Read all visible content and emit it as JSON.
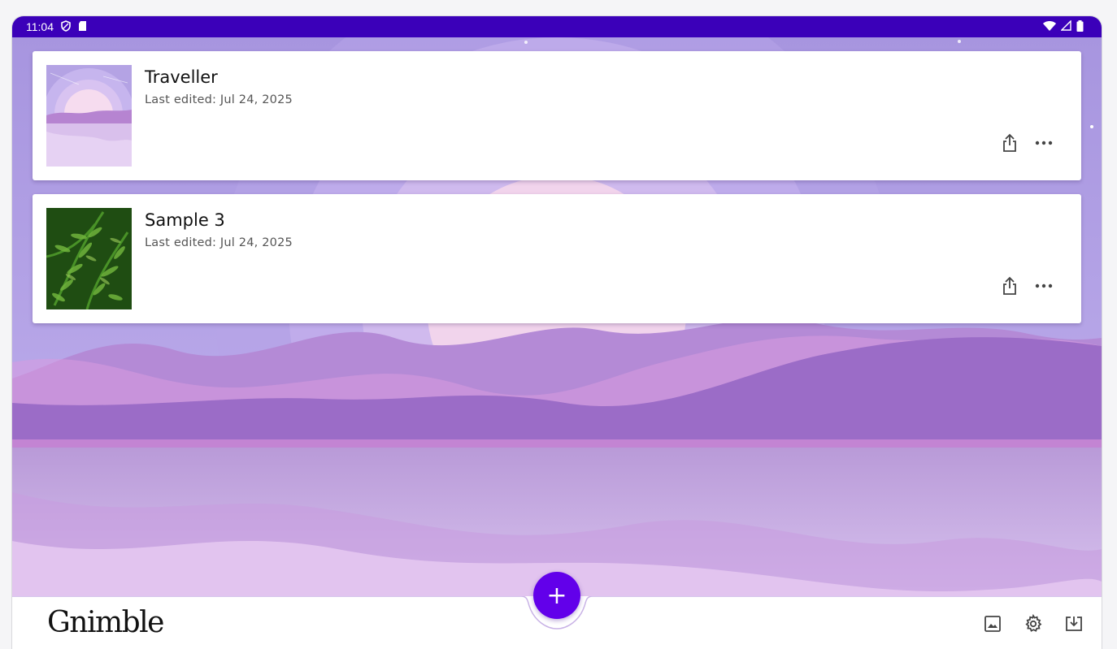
{
  "status_bar": {
    "time": "11:04",
    "icons_left": [
      "shield-icon",
      "sd-card-icon"
    ],
    "icons_right": [
      "wifi-icon",
      "cell-signal-icon",
      "battery-icon"
    ],
    "color": "#3b00b9"
  },
  "projects": [
    {
      "title": "Traveller",
      "subtitle": "Last edited: Jul 24, 2025",
      "thumbnail": "sunset-lake-thumbnail"
    },
    {
      "title": "Sample 3",
      "subtitle": "Last edited: Jul 24, 2025",
      "thumbnail": "fern-leaves-thumbnail"
    }
  ],
  "card_actions": [
    "share-icon",
    "more-options-icon"
  ],
  "fab": {
    "label": "+",
    "color": "#6200ea"
  },
  "bottom_bar": {
    "logo": "Gnimble",
    "actions": [
      "gallery-icon",
      "settings-icon",
      "import-icon"
    ]
  }
}
